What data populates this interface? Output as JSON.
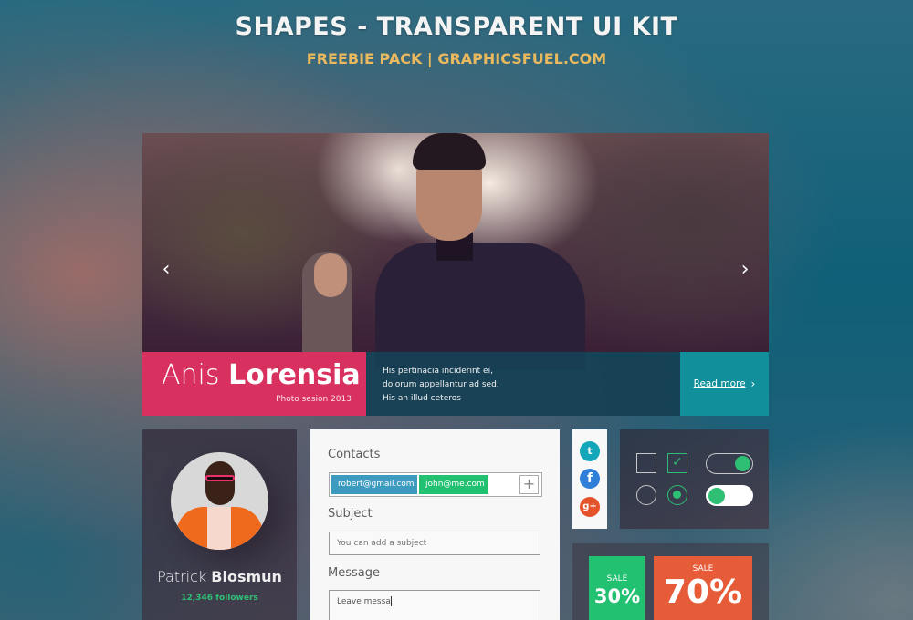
{
  "header": {
    "title": "SHAPES - TRANSPARENT UI KIT",
    "subtitle": "FREEBIE PACK | GRAPHICSFUEL.COM"
  },
  "hero": {
    "prev_icon": "‹",
    "next_icon": "›",
    "name_first": "Anis",
    "name_last": "Lorensia",
    "name_sub": "Photo sesion  2013",
    "text_lines": [
      "His pertinacia inciderint ei,",
      "dolorum appellantur ad sed.",
      "His an illud ceteros"
    ],
    "read_more": "Read more",
    "read_more_chevron": "›",
    "colors": {
      "name_bg": "#d8305f",
      "text_bg": "#164054",
      "more_bg": "#11909c"
    }
  },
  "profile": {
    "first_name": "Patrick",
    "last_name": "Blosmun",
    "followers": "12,346 followers",
    "followers_color": "#2fbf74"
  },
  "form": {
    "contacts_label": "Contacts",
    "contacts": [
      "robert@gmail.com",
      "john@me.com"
    ],
    "add_icon": "+",
    "subject_label": "Subject",
    "subject_placeholder": "You can add a subject",
    "message_label": "Message",
    "message_value": "Leave messa"
  },
  "social": {
    "twitter": "t",
    "facebook": "f",
    "googleplus": "g+"
  },
  "controls": {
    "checkbox_unchecked": false,
    "checkbox_checked": true,
    "check_glyph": "✓",
    "radio_unselected": false,
    "radio_selected": true,
    "toggle_1_on": true,
    "toggle_2_on": false,
    "accent": "#2fbf74"
  },
  "sales": [
    {
      "label": "SALE",
      "value": "30%",
      "color": "#22c071"
    },
    {
      "label": "SALE",
      "value": "70%",
      "color": "#e65c38"
    }
  ]
}
